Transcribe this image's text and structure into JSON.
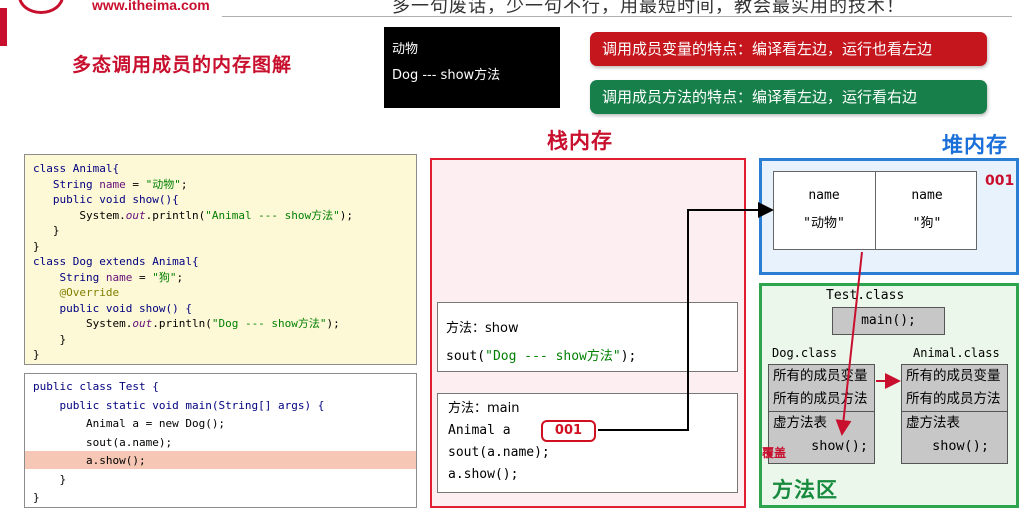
{
  "header": {
    "logo_url": "www.itheima.com",
    "slogan": "多一句废话，少一句不行，用最短时间，教会最实用的技术！"
  },
  "page_title": "多态调用成员的内存图解",
  "console_output": {
    "line1": "动物",
    "line2": "Dog --- show方法"
  },
  "rules": {
    "field_rule": "调用成员变量的特点：编译看左边，运行也看左边",
    "method_rule": "调用成员方法的特点：编译看左边，运行看右边"
  },
  "code_animal": {
    "l1": "class Animal{",
    "l2_kw": "String ",
    "l2_f": "name",
    "l2_eq": " = ",
    "l2_s": "\"动物\"",
    "l2_end": ";",
    "l3": "public void show(){",
    "l4_a": "System.",
    "l4_out": "out",
    "l4_b": ".println(",
    "l4_s": "\"Animal --- show方法\"",
    "l4_c": ");",
    "l5": "}",
    "l6": "}",
    "l7": "class Dog extends Animal{",
    "l8_kw": "String ",
    "l8_f": "name",
    "l8_eq": " = ",
    "l8_s": "\"狗\"",
    "l8_end": ";",
    "l9": "@Override",
    "l10": "public void show() {",
    "l11_a": "System.",
    "l11_out": "out",
    "l11_b": ".println(",
    "l11_s": "\"Dog --- show方法\"",
    "l11_c": ");",
    "l12": "}",
    "l13": "}"
  },
  "code_test": {
    "l1": "public class Test {",
    "l2": "public static void main(String[] args) {",
    "l3": "Animal a = new Dog();",
    "l4": "sout(a.name);",
    "l5": "a.show();",
    "l6": "}",
    "l7": "}"
  },
  "stack": {
    "title": "栈内存",
    "frame_show": {
      "header": "方法：show",
      "line_a": "sout(",
      "line_s": "\"Dog --- show方法\"",
      "line_b": ");"
    },
    "frame_main": {
      "header": "方法：main",
      "var": "Animal a",
      "ref": "001",
      "line1": "sout(a.name);",
      "line2": "a.show();"
    }
  },
  "heap": {
    "title": "堆内存",
    "address": "001",
    "cells": [
      {
        "name": "name",
        "value": "\"动物\""
      },
      {
        "name": "name",
        "value": "\"狗\""
      }
    ]
  },
  "method_area": {
    "title": "方法区",
    "test_class": "Test.class",
    "main_method": "main();",
    "dog_class": {
      "label": "Dog.class",
      "rows": [
        "所有的成员变量",
        "所有的成员方法",
        "虚方法表",
        "show();"
      ]
    },
    "animal_class": {
      "label": "Animal.class",
      "rows": [
        "所有的成员变量",
        "所有的成员方法",
        "虚方法表",
        "show();"
      ]
    },
    "override_label": "覆盖"
  },
  "colors": {
    "accent_red": "#c8102e",
    "heap_blue": "#2a7fd4",
    "method_green": "#2ea44f",
    "code_bg": "#fdf8d6"
  }
}
